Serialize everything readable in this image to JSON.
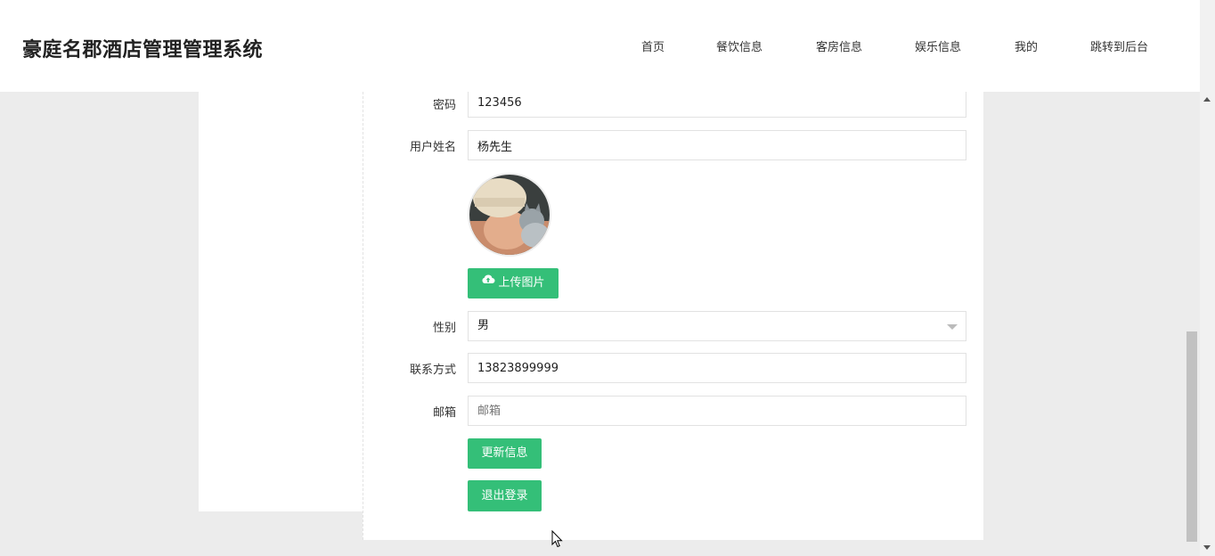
{
  "header": {
    "site_title": "豪庭名郡酒店管理管理系统",
    "nav": [
      "首页",
      "餐饮信息",
      "客房信息",
      "娱乐信息",
      "我的",
      "跳转到后台"
    ]
  },
  "form": {
    "password": {
      "label": "密码",
      "value": "123456"
    },
    "name": {
      "label": "用户姓名",
      "value": "杨先生"
    },
    "upload_label": "上传图片",
    "gender": {
      "label": "性别",
      "value": "男"
    },
    "phone": {
      "label": "联系方式",
      "value": "13823899999"
    },
    "email": {
      "label": "邮箱",
      "placeholder": "邮箱"
    },
    "update_label": "更新信息",
    "logout_label": "退出登录"
  },
  "colors": {
    "accent": "#34bf78",
    "background": "#ececec"
  },
  "icons": [
    "cloud-upload-icon",
    "chevron-down-icon",
    "scroll-up-icon",
    "scroll-down-icon",
    "mouse-cursor-icon"
  ]
}
